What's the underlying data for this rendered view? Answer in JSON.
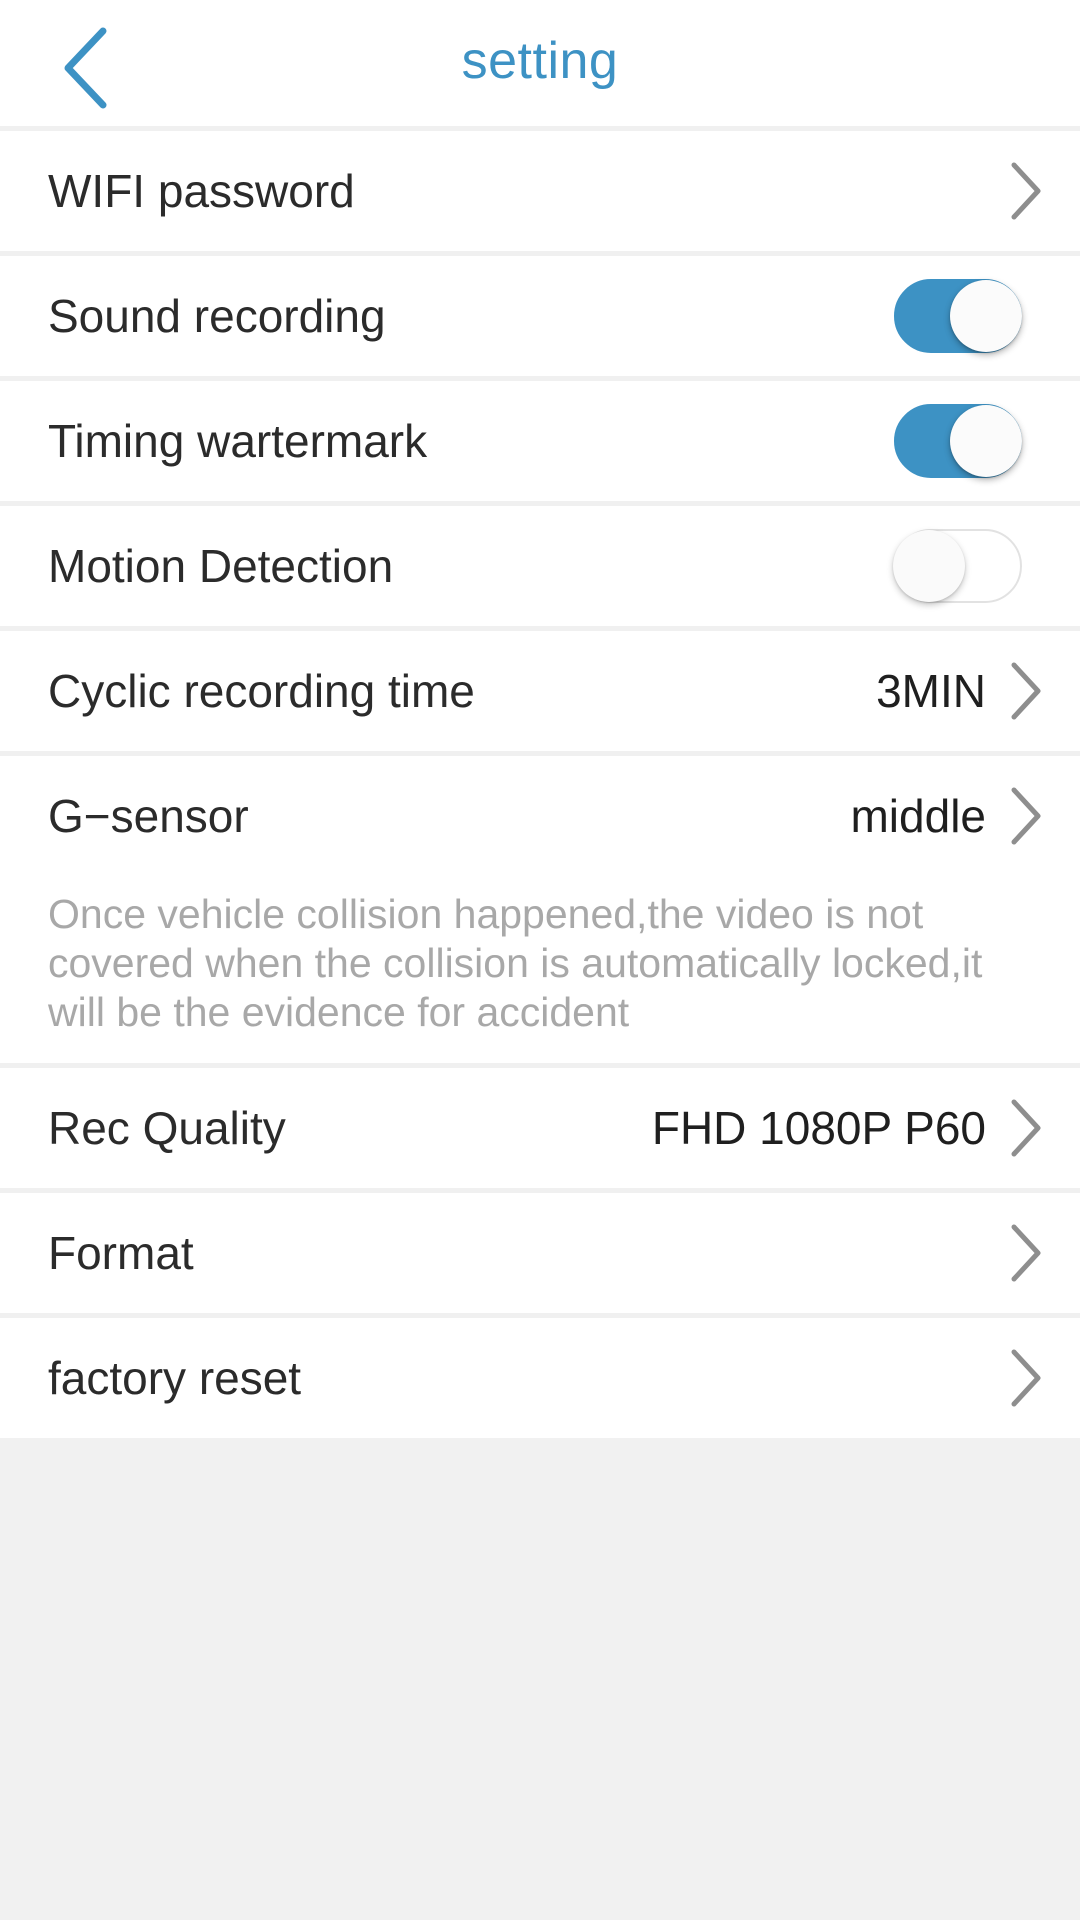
{
  "header": {
    "title": "setting",
    "back_icon": "chevron-left-icon",
    "accent_color": "#3d92c4"
  },
  "colors": {
    "accent": "#3d92c4",
    "row_background": "#ffffff",
    "page_background": "#f1f1f1",
    "separator": "#f0f0f0",
    "label_text": "#2b2b2b",
    "value_text": "#1f1f1f",
    "description_text": "#a8a8a8",
    "chevron": "#8e8e8e",
    "toggle_off_border": "#e2e2e2"
  },
  "rows": [
    {
      "label": "WIFI password",
      "value": "",
      "type": "link",
      "icon": "chevron-right-icon"
    },
    {
      "label": "Sound recording",
      "value": "",
      "type": "toggle",
      "state": "on"
    },
    {
      "label": "Timing wartermark",
      "value": "",
      "type": "toggle",
      "state": "on"
    },
    {
      "label": "Motion Detection",
      "value": "",
      "type": "toggle",
      "state": "off"
    },
    {
      "label": "Cyclic recording time",
      "value": "3MIN",
      "type": "link",
      "icon": "chevron-right-icon"
    },
    {
      "label": "G−sensor",
      "value": "middle",
      "type": "link",
      "icon": "chevron-right-icon"
    },
    {
      "label": "Rec Quality",
      "value": "FHD 1080P P60",
      "type": "link",
      "icon": "chevron-right-icon"
    },
    {
      "label": "Format",
      "value": "",
      "type": "link",
      "icon": "chevron-right-icon"
    },
    {
      "label": "factory reset",
      "value": "",
      "type": "link",
      "icon": "chevron-right-icon"
    }
  ],
  "description": {
    "text": "Once vehicle collision happened,the video is not covered when the collision is automatically locked,it will be the evidence for accident"
  }
}
